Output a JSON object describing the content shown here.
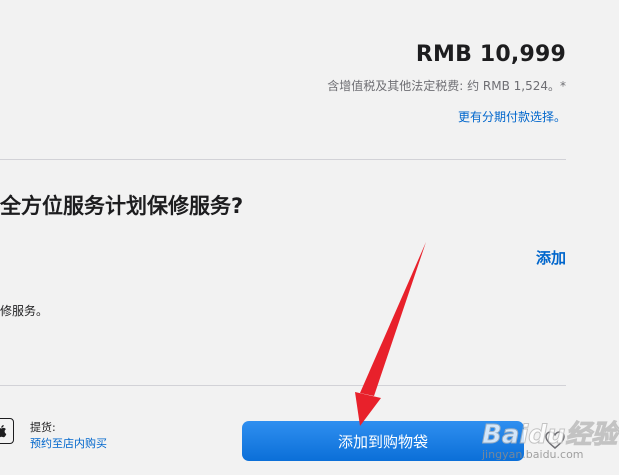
{
  "pricing": {
    "price": "RMB 10,999",
    "tax_note": "含增值税及其他法定税费: 约 RMB 1,524。*",
    "installment_link": "更有分期付款选择。"
  },
  "service": {
    "heading": "全方位服务计划保修服务?",
    "add_link": "添加",
    "description": "修服务。"
  },
  "pickup": {
    "label": "提货:",
    "link": "预约至店内购买"
  },
  "actions": {
    "add_to_bag": "添加到购物袋"
  },
  "watermark": {
    "brand": "Baidu经验",
    "domain": "jingyan.baidu.com"
  },
  "colors": {
    "accent": "#0066cc",
    "button": "#0b6fd8",
    "annotation_arrow": "#e8212b"
  }
}
